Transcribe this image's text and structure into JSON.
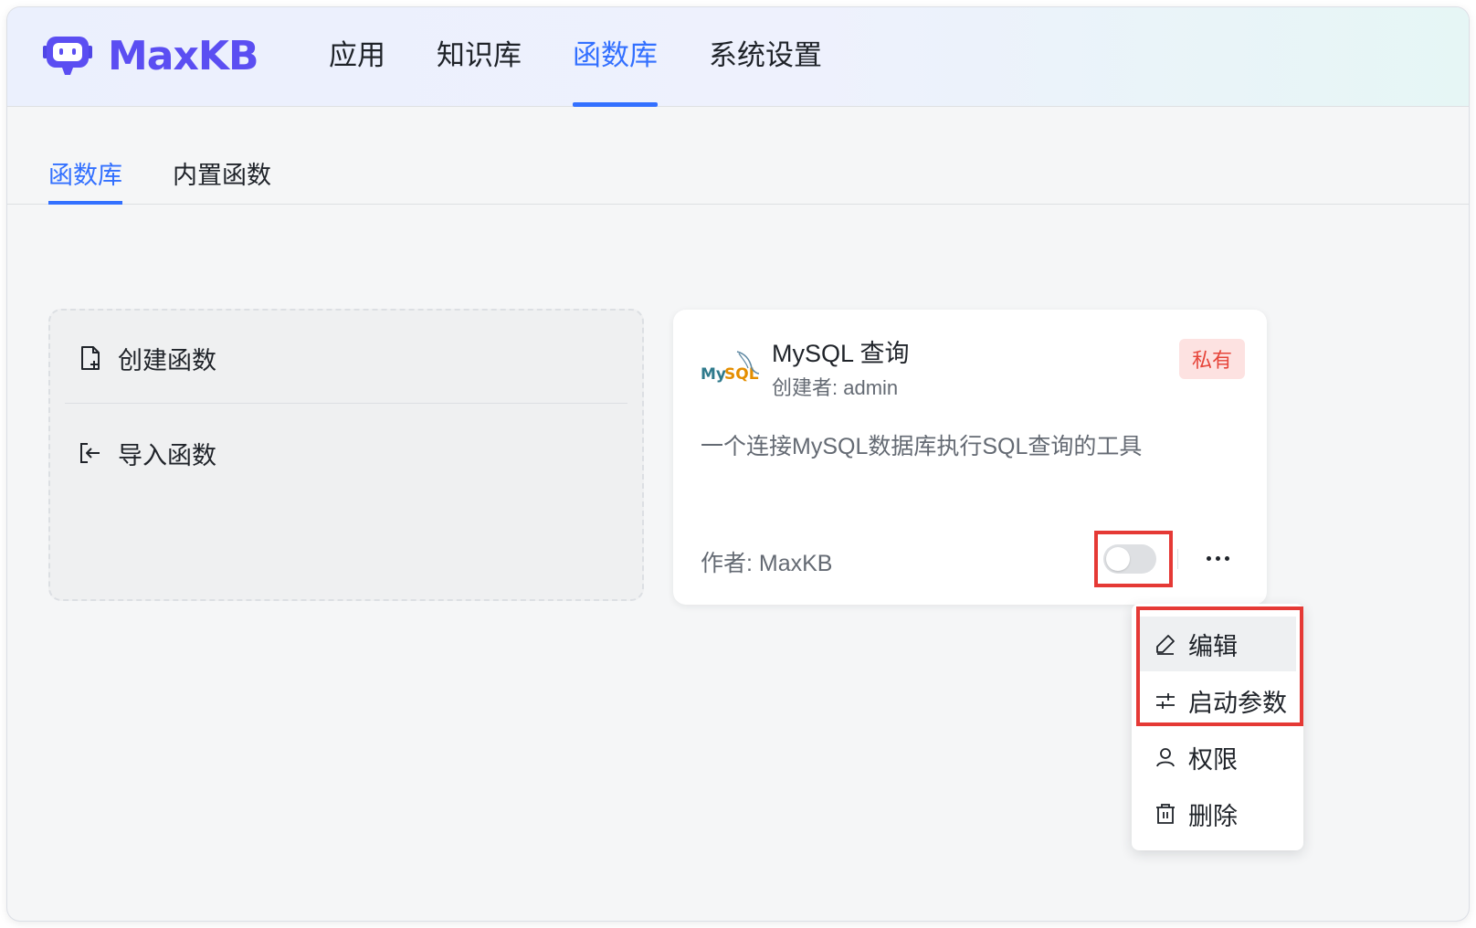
{
  "header": {
    "logo_text": "MaxKB",
    "nav": [
      {
        "label": "应用",
        "active": false
      },
      {
        "label": "知识库",
        "active": false
      },
      {
        "label": "函数库",
        "active": true
      },
      {
        "label": "系统设置",
        "active": false
      }
    ],
    "accent_color": "#3370ff"
  },
  "subtabs": [
    {
      "label": "函数库",
      "active": true
    },
    {
      "label": "内置函数",
      "active": false
    }
  ],
  "create_card": {
    "create_label": "创建函数",
    "import_label": "导入函数"
  },
  "function_card": {
    "title": "MySQL 查询",
    "creator": "创建者: admin",
    "tag": "私有",
    "description": "一个连接MySQL数据库执行SQL查询的工具",
    "author": "作者: MaxKB",
    "enabled": false
  },
  "dropdown": {
    "items": [
      {
        "label": "编辑",
        "icon": "edit-icon"
      },
      {
        "label": "启动参数",
        "icon": "sliders-icon"
      },
      {
        "label": "权限",
        "icon": "user-icon"
      },
      {
        "label": "删除",
        "icon": "trash-icon"
      }
    ]
  },
  "highlight_color": "#e53935"
}
